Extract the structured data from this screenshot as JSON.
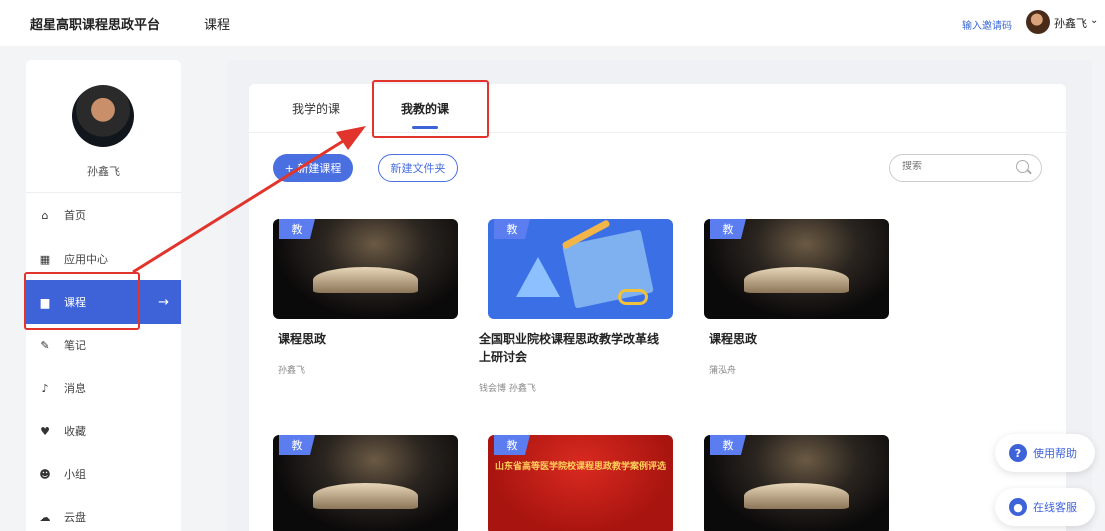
{
  "header": {
    "brand": "超星高职课程思政平台",
    "nav_course": "课程",
    "invite": "输入邀请码",
    "user_name": "孙鑫飞",
    "chevron": "⌄"
  },
  "sidebar": {
    "user_name": "孙鑫飞",
    "items": [
      {
        "label": "首页",
        "icon": "home-icon",
        "glyph": "⌂"
      },
      {
        "label": "应用中心",
        "icon": "apps-icon",
        "glyph": "▦"
      },
      {
        "label": "课程",
        "icon": "course-icon",
        "glyph": "▆"
      },
      {
        "label": "笔记",
        "icon": "note-icon",
        "glyph": "✎"
      },
      {
        "label": "消息",
        "icon": "bell-icon",
        "glyph": "♪"
      },
      {
        "label": "收藏",
        "icon": "heart-icon",
        "glyph": "♥"
      },
      {
        "label": "小组",
        "icon": "group-icon",
        "glyph": "☻"
      },
      {
        "label": "云盘",
        "icon": "cloud-icon",
        "glyph": "☁"
      }
    ],
    "active_arrow": "→"
  },
  "tabs": {
    "study": "我学的课",
    "teach": "我教的课"
  },
  "toolbar": {
    "new_course": "+ 新建课程",
    "new_folder": "新建文件夹",
    "search_placeholder": "搜索"
  },
  "courses": [
    {
      "badge": "教",
      "title": "课程思政",
      "teacher": "孙鑫飞"
    },
    {
      "badge": "教",
      "title": "全国职业院校课程思政教学改革线上研讨会",
      "teacher": "钱会博 孙鑫飞"
    },
    {
      "badge": "教",
      "title": "课程思政",
      "teacher": "蒲泓舟"
    },
    {
      "badge": "教",
      "title": "",
      "teacher": ""
    },
    {
      "badge": "教",
      "banner": "山东省高等医学院校课程思政教学案例评选",
      "title": "",
      "teacher": ""
    },
    {
      "badge": "教",
      "title": "",
      "teacher": ""
    }
  ],
  "float": {
    "help": "使用帮助",
    "service": "在线客服"
  },
  "colors": {
    "accent": "#3e63d8",
    "annotation": "#e0342c"
  }
}
